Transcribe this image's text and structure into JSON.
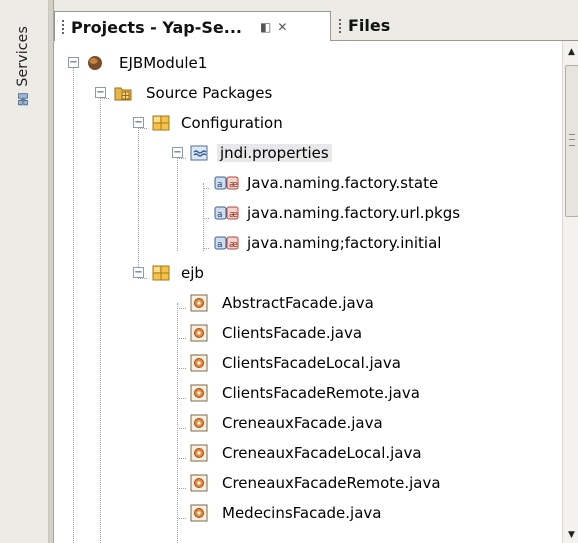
{
  "sidebar": {
    "services_label": "Services",
    "services_icon": "services-icon"
  },
  "panel": {
    "tabs": [
      {
        "label": "Projects - Yap-Se...",
        "active": true,
        "restore_glyph": "◧",
        "close_glyph": "✕"
      },
      {
        "label": "Files",
        "active": false
      }
    ]
  },
  "tree": {
    "nodes": [
      {
        "label": "EJBModule1",
        "icon": "ejb-module-icon",
        "expanded": true
      },
      {
        "label": "Source Packages",
        "icon": "source-packages-icon",
        "expanded": true
      },
      {
        "label": "Configuration",
        "icon": "package-icon",
        "expanded": true
      },
      {
        "label": "jndi.properties",
        "icon": "properties-file-icon",
        "expanded": true,
        "selected": true
      },
      {
        "label": "Java.naming.factory.state",
        "icon": "property-icon"
      },
      {
        "label": "java.naming.factory.url.pkgs",
        "icon": "property-icon"
      },
      {
        "label": "java.naming;factory.initial",
        "icon": "property-icon"
      },
      {
        "label": "ejb",
        "icon": "package-icon",
        "expanded": true
      },
      {
        "label": "AbstractFacade.java",
        "icon": "java-class-icon"
      },
      {
        "label": "ClientsFacade.java",
        "icon": "java-class-icon"
      },
      {
        "label": "ClientsFacadeLocal.java",
        "icon": "java-class-icon"
      },
      {
        "label": "ClientsFacadeRemote.java",
        "icon": "java-class-icon"
      },
      {
        "label": "CreneauxFacade.java",
        "icon": "java-class-icon"
      },
      {
        "label": "CreneauxFacadeLocal.java",
        "icon": "java-class-icon"
      },
      {
        "label": "CreneauxFacadeRemote.java",
        "icon": "java-class-icon"
      },
      {
        "label": "MedecinsFacade.java",
        "icon": "java-class-icon"
      }
    ]
  },
  "expander_glyph": "−",
  "scrollbar": {
    "up_glyph": "▲",
    "down_glyph": "▼"
  }
}
